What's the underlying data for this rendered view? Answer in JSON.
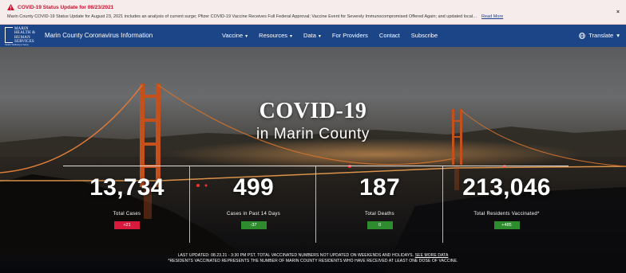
{
  "alert": {
    "title": "COVID-19 Status Update for 08/23/2021",
    "text": "Marin County COVID-19 Status Update for August 23, 2021 includes an analysis of current surge; Pfizer COVID-19 Vaccine Receives Full Federal Approval; Vaccine Event for Severely Immunocompromised Offered Again; and updated local…",
    "read_more": "Read More",
    "close": "×"
  },
  "nav": {
    "logo_lines": [
      "MARIN",
      "HEALTH &",
      "HUMAN",
      "SERVICES"
    ],
    "logo_tagline": "Health, Wellbeing & Safety",
    "site_title": "Marin County Coronavirus Information",
    "menu": [
      {
        "label": "Vaccine",
        "chevron": "▾"
      },
      {
        "label": "Resources",
        "chevron": "▾"
      },
      {
        "label": "Data",
        "chevron": "▾"
      },
      {
        "label": "For Providers",
        "chevron": ""
      },
      {
        "label": "Contact",
        "chevron": ""
      },
      {
        "label": "Subscribe",
        "chevron": ""
      }
    ],
    "translate": "Translate",
    "translate_chevron": "▾"
  },
  "hero": {
    "title": "COVID-19",
    "subtitle": "in Marin County",
    "stats": [
      {
        "number": "13,734",
        "label": "Total Cases",
        "badge": "+21",
        "badge_color": "#d81b3c"
      },
      {
        "number": "499",
        "label": "Cases in Past 14 Days",
        "badge": "-37",
        "badge_color": "#2e8b2e"
      },
      {
        "number": "187",
        "label": "Total Deaths",
        "badge": "0",
        "badge_color": "#2e8b2e"
      },
      {
        "number": "213,046",
        "label": "Total Residents Vaccinated*",
        "badge": "+485",
        "badge_color": "#2e8b2e"
      }
    ],
    "footnote_1": "LAST UPDATED: 08.23.21 - 3:30 PM PST. TOTAL VACCINATED NUMBERS NOT UPDATED ON WEEKENDS AND HOLIDAYS.",
    "footnote_link": "SEE MORE DATA",
    "footnote_2": "*RESIDENTS VACCINATED REPRESENTS THE NUMBER OF MARIN COUNTY RESIDENTS WHO HAVE RECEIVED AT LEAST ONE DOSE OF VACCINE."
  },
  "colors": {
    "alert_bg": "#f7ecec",
    "alert_title": "#c8102e",
    "nav_bg": "#1c4588",
    "bridge": "#c4501c"
  }
}
